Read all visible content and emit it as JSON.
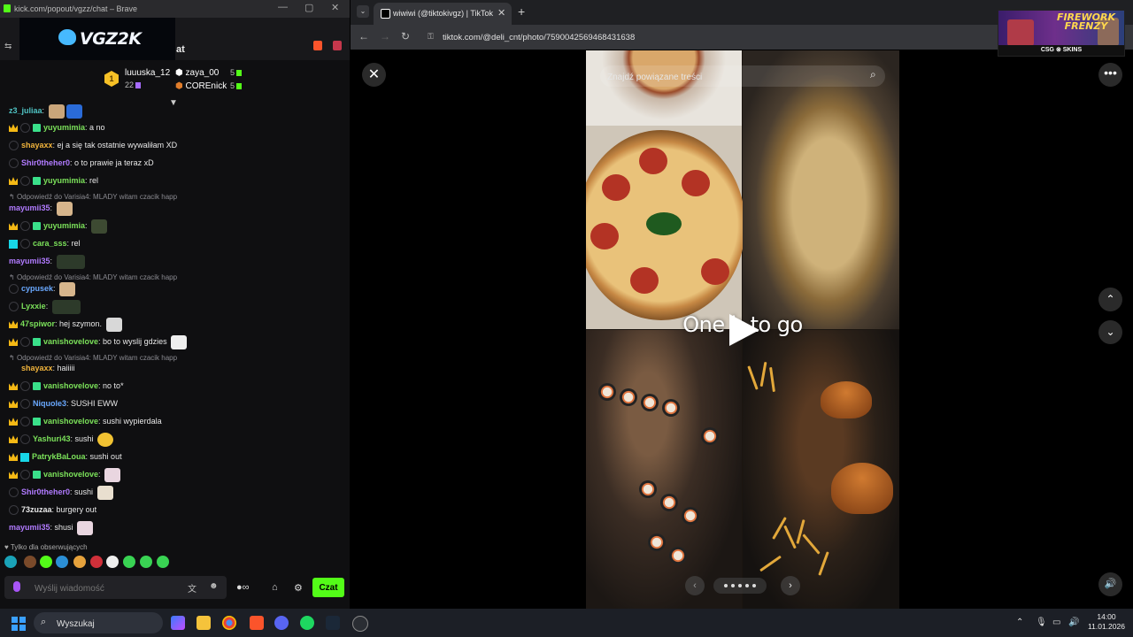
{
  "chat_window": {
    "title": "kick.com/popout/vgzz/chat – Brave",
    "logo_text": "VGZ2K",
    "chat_label": "at",
    "leaderboard": [
      {
        "rank": "1",
        "name": "luuuska_12",
        "count": "22"
      },
      {
        "name": "zaya_00",
        "count": "5"
      },
      {
        "name": "COREnick",
        "count": "5"
      }
    ],
    "messages": [
      {
        "user": "z3_juliaa",
        "text": ""
      },
      {
        "user": "yuyumimia",
        "text": "a no"
      },
      {
        "user": "shayaxx",
        "text": "ej a się tak ostatnie wywaliłam XD"
      },
      {
        "user": "Shir0theher0",
        "text": "o to prawie ja teraz xD"
      },
      {
        "user": "yuyumimia",
        "text": "rel"
      },
      {
        "reply": "Odpowiedź do Varisia4: MLADY witam czacik happ"
      },
      {
        "user": "mayumii35",
        "text": ""
      },
      {
        "user": "yuyumimia",
        "text": ""
      },
      {
        "user": "cara_sss",
        "text": "rel"
      },
      {
        "user": "mayumii35",
        "text": ""
      },
      {
        "reply": "Odpowiedź do Varisia4: MLADY witam czacik happ"
      },
      {
        "user": "cypusek",
        "text": ""
      },
      {
        "user": "Lyxxie",
        "text": ""
      },
      {
        "user": "47spiwor",
        "text": "hej szymon."
      },
      {
        "user": "vanishovelove",
        "text": "bo to wyslij gdzies"
      },
      {
        "reply": "Odpowiedź do Varisia4: MLADY witam czacik happ"
      },
      {
        "user": "shayaxx",
        "text": "haiiiii"
      },
      {
        "user": "vanishovelove",
        "text": "no to*"
      },
      {
        "user": "Niquole3",
        "text": "SUSHI EWW"
      },
      {
        "user": "vanishovelove",
        "text": "sushi wypierdala"
      },
      {
        "user": "Yashuri43",
        "text": "sushi"
      },
      {
        "user": "PatrykBaLoua",
        "text": "sushi out"
      },
      {
        "user": "vanishovelove",
        "text": ""
      },
      {
        "user": "Shir0theher0",
        "text": "sushi"
      },
      {
        "user": "73zuzaa",
        "text": "burgery out"
      },
      {
        "user": "mayumii35",
        "text": "shusi"
      }
    ],
    "followers_only": "Tylko dla obserwujących",
    "input_placeholder": "Wyślij wiadomość",
    "send_label": "Czat"
  },
  "browser": {
    "tab_title": "wiwiwi (@tiktokivgz) | TikTok",
    "url": "tiktok.com/@deli_cnt/photo/7590042569468431638",
    "search_placeholder": "Znajdź powiązane treści",
    "caption": "One h      to go",
    "stream_overlay": {
      "title": "FIREWORK FRENZY",
      "sponsor": "CSG ⊗ SKINS"
    }
  },
  "taskbar": {
    "search_placeholder": "Wyszukaj",
    "time": "14:00",
    "date": "11.01.2026"
  }
}
